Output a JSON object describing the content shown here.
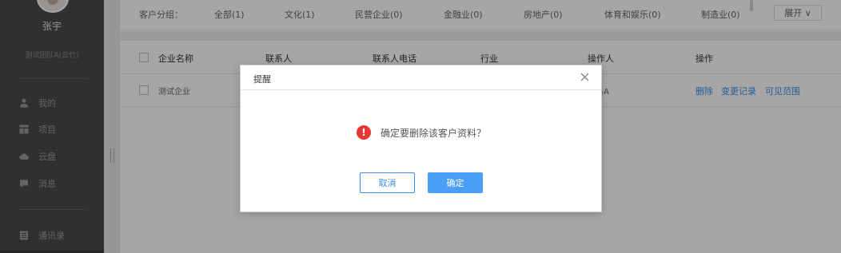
{
  "sidebar": {
    "user_name": "张宇",
    "team": "测试团队A(云竹)",
    "items": [
      {
        "label": "我的",
        "icon": "person-icon"
      },
      {
        "label": "项目",
        "icon": "grid-icon"
      },
      {
        "label": "云盘",
        "icon": "cloud-icon"
      },
      {
        "label": "消息",
        "icon": "chat-icon"
      },
      {
        "label": "通讯录",
        "icon": "list-icon"
      }
    ]
  },
  "filter": {
    "label": "客户分组：",
    "options": [
      "全部(1)",
      "文化(1)",
      "民营企业(0)",
      "金融业(0)",
      "房地产(0)",
      "体育和娱乐(0)",
      "制造业(0)"
    ],
    "expand_label": "展开 ∨"
  },
  "table": {
    "headers": [
      "企业名称",
      "联系人",
      "联系人电话",
      "行业",
      "操作人",
      "操作"
    ],
    "rows": [
      {
        "company": "测试企业",
        "operator": "成员A",
        "actions": [
          "删除",
          "变更记录",
          "可见范围"
        ]
      }
    ]
  },
  "dialog": {
    "title": "提醒",
    "message": "确定要删除该客户资料？",
    "cancel_label": "取消",
    "ok_label": "确定"
  },
  "colors": {
    "accent": "#3a8ee6",
    "warning": "#e53935",
    "sidebar_bg": "#4a4a4a"
  }
}
